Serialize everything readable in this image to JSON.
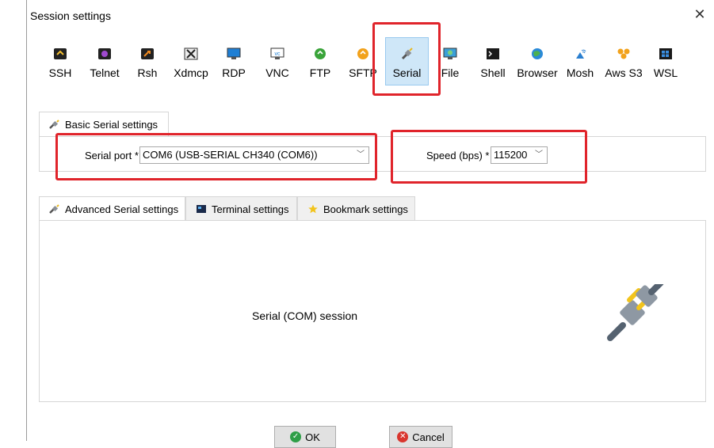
{
  "window": {
    "title": "Session settings"
  },
  "toolbar": {
    "items": [
      {
        "label": "SSH",
        "icon": "ssh-icon"
      },
      {
        "label": "Telnet",
        "icon": "telnet-icon"
      },
      {
        "label": "Rsh",
        "icon": "rsh-icon"
      },
      {
        "label": "Xdmcp",
        "icon": "xdmcp-icon"
      },
      {
        "label": "RDP",
        "icon": "rdp-icon"
      },
      {
        "label": "VNC",
        "icon": "vnc-icon"
      },
      {
        "label": "FTP",
        "icon": "ftp-icon"
      },
      {
        "label": "SFTP",
        "icon": "sftp-icon"
      },
      {
        "label": "Serial",
        "icon": "serial-icon",
        "selected": true
      },
      {
        "label": "File",
        "icon": "file-icon"
      },
      {
        "label": "Shell",
        "icon": "shell-icon"
      },
      {
        "label": "Browser",
        "icon": "browser-icon"
      },
      {
        "label": "Mosh",
        "icon": "mosh-icon"
      },
      {
        "label": "Aws S3",
        "icon": "aws-s3-icon"
      },
      {
        "label": "WSL",
        "icon": "wsl-icon"
      }
    ]
  },
  "basic": {
    "tab_label": "Basic Serial settings",
    "serial_port_label": "Serial port *",
    "serial_port_value": "COM6  (USB-SERIAL CH340 (COM6))",
    "speed_label": "Speed (bps) *",
    "speed_value": "115200"
  },
  "advanced_tabs": [
    {
      "label": "Advanced Serial settings"
    },
    {
      "label": "Terminal settings"
    },
    {
      "label": "Bookmark settings"
    }
  ],
  "session_panel": {
    "text": "Serial (COM) session"
  },
  "buttons": {
    "ok": "OK",
    "cancel": "Cancel"
  },
  "colors": {
    "selected_bg": "#cfe7f8",
    "highlight_red": "#e0242b",
    "ok_green": "#2e9e47",
    "cancel_red": "#d9362e"
  }
}
